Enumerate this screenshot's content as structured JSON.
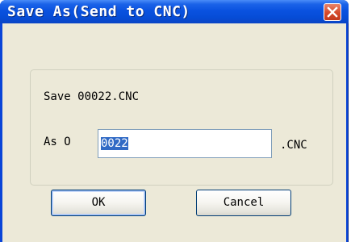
{
  "window": {
    "title": "Save As(Send to CNC)"
  },
  "dialog": {
    "save_text": "Save 00022.CNC",
    "as_label": "As O",
    "filename_value": "0022",
    "extension_label": ".CNC"
  },
  "buttons": {
    "ok_label": "OK",
    "cancel_label": "Cancel"
  },
  "colors": {
    "titlebar": "#0a52e0",
    "client": "#ece9d8",
    "close_button": "#d4492b",
    "selection": "#316ac5"
  },
  "icons": {
    "close": "close-icon"
  }
}
